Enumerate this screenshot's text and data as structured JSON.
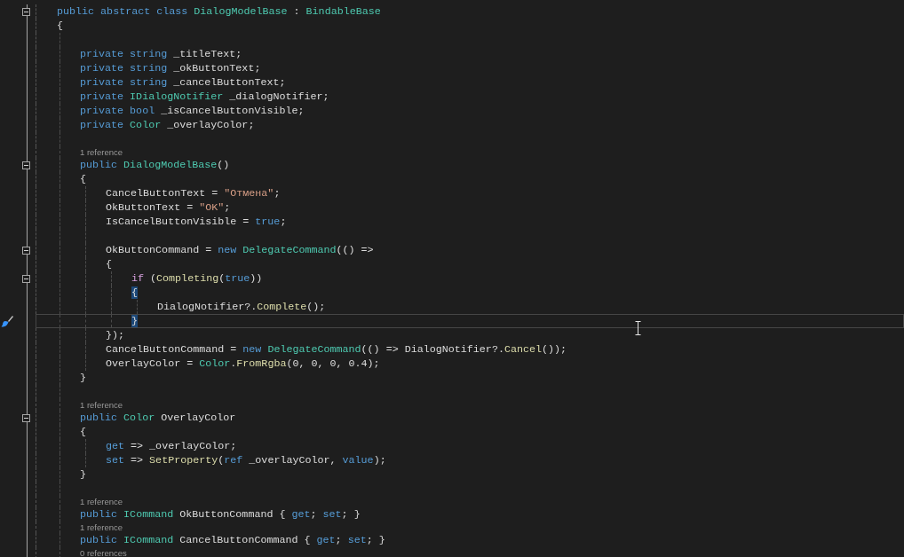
{
  "editor": {
    "lines": [
      {
        "kind": "code",
        "fold": true,
        "current": false,
        "tokens": [
          {
            "text": "public ",
            "kind": "kw"
          },
          {
            "text": "abstract ",
            "kind": "kw"
          },
          {
            "text": "class ",
            "kind": "kw"
          },
          {
            "text": "DialogModelBase",
            "kind": "type"
          },
          {
            "text": " : ",
            "kind": "p"
          },
          {
            "text": "BindableBase",
            "kind": "type"
          }
        ]
      },
      {
        "kind": "code",
        "fold": false,
        "current": false,
        "tokens": [
          {
            "text": "{",
            "kind": "p"
          }
        ]
      },
      {
        "kind": "blank"
      },
      {
        "kind": "code",
        "fold": false,
        "current": false,
        "tokens": [
          {
            "text": "    private string ",
            "kind": "kw"
          },
          {
            "text": "_titleText;",
            "kind": "p"
          }
        ]
      },
      {
        "kind": "code",
        "fold": false,
        "current": false,
        "tokens": [
          {
            "text": "    private string ",
            "kind": "kw"
          },
          {
            "text": "_okButtonText;",
            "kind": "p"
          }
        ]
      },
      {
        "kind": "code",
        "fold": false,
        "current": false,
        "tokens": [
          {
            "text": "    private string ",
            "kind": "kw"
          },
          {
            "text": "_cancelButtonText;",
            "kind": "p"
          }
        ]
      },
      {
        "kind": "code",
        "fold": false,
        "current": false,
        "tokens": [
          {
            "text": "    private ",
            "kind": "kw"
          },
          {
            "text": "IDialogNotifier",
            "kind": "type"
          },
          {
            "text": " _dialogNotifier;",
            "kind": "p"
          }
        ]
      },
      {
        "kind": "code",
        "fold": false,
        "current": false,
        "tokens": [
          {
            "text": "    private bool ",
            "kind": "kw"
          },
          {
            "text": "_isCancelButtonVisible;",
            "kind": "p"
          }
        ]
      },
      {
        "kind": "code",
        "fold": false,
        "current": false,
        "tokens": [
          {
            "text": "    private ",
            "kind": "kw"
          },
          {
            "text": "Color",
            "kind": "type"
          },
          {
            "text": " _overlayColor;",
            "kind": "p"
          }
        ]
      },
      {
        "kind": "blank"
      },
      {
        "kind": "lens",
        "text": "    1 reference"
      },
      {
        "kind": "code",
        "fold": true,
        "current": false,
        "tokens": [
          {
            "text": "    public ",
            "kind": "kw"
          },
          {
            "text": "DialogModelBase",
            "kind": "type"
          },
          {
            "text": "()",
            "kind": "p"
          }
        ]
      },
      {
        "kind": "code",
        "fold": false,
        "current": false,
        "tokens": [
          {
            "text": "    {",
            "kind": "p"
          }
        ]
      },
      {
        "kind": "code",
        "fold": false,
        "current": false,
        "tokens": [
          {
            "text": "        CancelButtonText = ",
            "kind": "p"
          },
          {
            "text": "\"Отмена\"",
            "kind": "str"
          },
          {
            "text": ";",
            "kind": "p"
          }
        ]
      },
      {
        "kind": "code",
        "fold": false,
        "current": false,
        "tokens": [
          {
            "text": "        OkButtonText = ",
            "kind": "p"
          },
          {
            "text": "\"OK\"",
            "kind": "str"
          },
          {
            "text": ";",
            "kind": "p"
          }
        ]
      },
      {
        "kind": "code",
        "fold": false,
        "current": false,
        "tokens": [
          {
            "text": "        IsCancelButtonVisible = ",
            "kind": "p"
          },
          {
            "text": "true",
            "kind": "kw"
          },
          {
            "text": ";",
            "kind": "p"
          }
        ]
      },
      {
        "kind": "blank"
      },
      {
        "kind": "code",
        "fold": true,
        "current": false,
        "tokens": [
          {
            "text": "        OkButtonCommand = ",
            "kind": "p"
          },
          {
            "text": "new ",
            "kind": "kw"
          },
          {
            "text": "DelegateCommand",
            "kind": "type"
          },
          {
            "text": "(() =>",
            "kind": "p"
          }
        ]
      },
      {
        "kind": "code",
        "fold": false,
        "current": false,
        "tokens": [
          {
            "text": "        {",
            "kind": "p"
          }
        ]
      },
      {
        "kind": "code",
        "fold": true,
        "current": false,
        "tokens": [
          {
            "text": "            if ",
            "kind": "ctl"
          },
          {
            "text": "(",
            "kind": "p"
          },
          {
            "text": "Completing",
            "kind": "method"
          },
          {
            "text": "(",
            "kind": "p"
          },
          {
            "text": "true",
            "kind": "kw"
          },
          {
            "text": "))",
            "kind": "p"
          }
        ]
      },
      {
        "kind": "code",
        "fold": false,
        "current": false,
        "tokens": [
          {
            "text": "            {",
            "kind": "brace"
          }
        ]
      },
      {
        "kind": "code",
        "fold": false,
        "current": false,
        "tokens": [
          {
            "text": "                DialogNotifier?.",
            "kind": "p"
          },
          {
            "text": "Complete",
            "kind": "method"
          },
          {
            "text": "();",
            "kind": "p"
          }
        ]
      },
      {
        "kind": "code",
        "fold": false,
        "current": true,
        "tokens": [
          {
            "text": "            }",
            "kind": "brace"
          }
        ]
      },
      {
        "kind": "code",
        "fold": false,
        "current": false,
        "tokens": [
          {
            "text": "        });",
            "kind": "p"
          }
        ]
      },
      {
        "kind": "code",
        "fold": false,
        "current": false,
        "tokens": [
          {
            "text": "        CancelButtonCommand = ",
            "kind": "p"
          },
          {
            "text": "new ",
            "kind": "kw"
          },
          {
            "text": "DelegateCommand",
            "kind": "type"
          },
          {
            "text": "(() => DialogNotifier?.",
            "kind": "p"
          },
          {
            "text": "Cancel",
            "kind": "method"
          },
          {
            "text": "());",
            "kind": "p"
          }
        ]
      },
      {
        "kind": "code",
        "fold": false,
        "current": false,
        "tokens": [
          {
            "text": "        OverlayColor = ",
            "kind": "p"
          },
          {
            "text": "Color",
            "kind": "type"
          },
          {
            "text": ".",
            "kind": "p"
          },
          {
            "text": "FromRgba",
            "kind": "method"
          },
          {
            "text": "(0, 0, 0, 0.4);",
            "kind": "p"
          }
        ]
      },
      {
        "kind": "code",
        "fold": false,
        "current": false,
        "tokens": [
          {
            "text": "    }",
            "kind": "p"
          }
        ]
      },
      {
        "kind": "blank"
      },
      {
        "kind": "lens",
        "text": "    1 reference"
      },
      {
        "kind": "code",
        "fold": true,
        "current": false,
        "tokens": [
          {
            "text": "    public ",
            "kind": "kw"
          },
          {
            "text": "Color",
            "kind": "type"
          },
          {
            "text": " OverlayColor",
            "kind": "p"
          }
        ]
      },
      {
        "kind": "code",
        "fold": false,
        "current": false,
        "tokens": [
          {
            "text": "    {",
            "kind": "p"
          }
        ]
      },
      {
        "kind": "code",
        "fold": false,
        "current": false,
        "tokens": [
          {
            "text": "        get",
            "kind": "kw"
          },
          {
            "text": " => _overlayColor;",
            "kind": "p"
          }
        ]
      },
      {
        "kind": "code",
        "fold": false,
        "current": false,
        "tokens": [
          {
            "text": "        set",
            "kind": "kw"
          },
          {
            "text": " => ",
            "kind": "p"
          },
          {
            "text": "SetProperty",
            "kind": "method"
          },
          {
            "text": "(",
            "kind": "p"
          },
          {
            "text": "ref",
            "kind": "kw"
          },
          {
            "text": " _overlayColor, ",
            "kind": "p"
          },
          {
            "text": "value",
            "kind": "kw"
          },
          {
            "text": ");",
            "kind": "p"
          }
        ]
      },
      {
        "kind": "code",
        "fold": false,
        "current": false,
        "tokens": [
          {
            "text": "    }",
            "kind": "p"
          }
        ]
      },
      {
        "kind": "blank"
      },
      {
        "kind": "lens",
        "text": "    1 reference"
      },
      {
        "kind": "code",
        "fold": false,
        "current": false,
        "tokens": [
          {
            "text": "    public ",
            "kind": "kw"
          },
          {
            "text": "ICommand",
            "kind": "type"
          },
          {
            "text": " OkButtonCommand { ",
            "kind": "p"
          },
          {
            "text": "get",
            "kind": "kw"
          },
          {
            "text": "; ",
            "kind": "p"
          },
          {
            "text": "set",
            "kind": "kw"
          },
          {
            "text": "; }",
            "kind": "p"
          }
        ]
      },
      {
        "kind": "lens",
        "text": "    1 reference"
      },
      {
        "kind": "code",
        "fold": false,
        "current": false,
        "tokens": [
          {
            "text": "    public ",
            "kind": "kw"
          },
          {
            "text": "ICommand",
            "kind": "type"
          },
          {
            "text": " CancelButtonCommand { ",
            "kind": "p"
          },
          {
            "text": "get",
            "kind": "kw"
          },
          {
            "text": "; ",
            "kind": "p"
          },
          {
            "text": "set",
            "kind": "kw"
          },
          {
            "text": "; }",
            "kind": "p"
          }
        ]
      },
      {
        "kind": "lens",
        "text": "    0 references"
      }
    ]
  }
}
